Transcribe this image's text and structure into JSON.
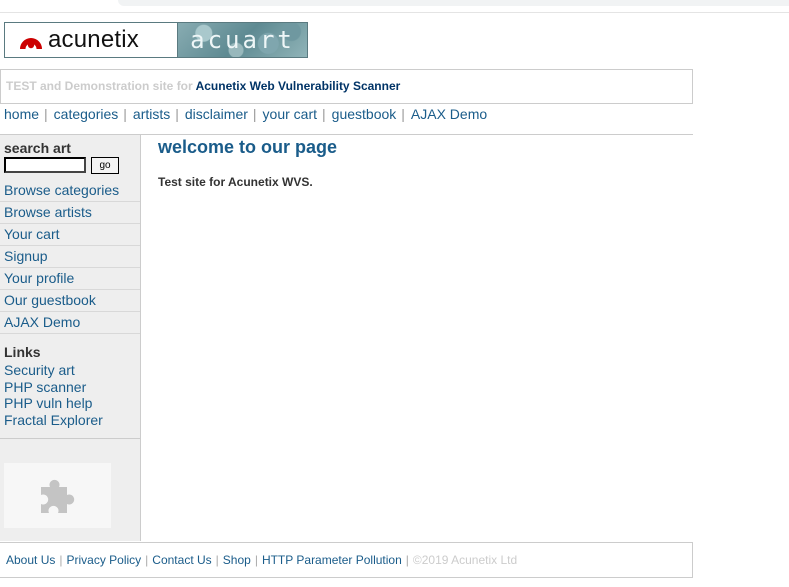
{
  "logo": {
    "left_text": "acunetix",
    "right_text": "acuart",
    "brand_color": "#cc0000"
  },
  "tagline": {
    "prefix": "TEST and Demonstration site for",
    "product": "Acunetix Web Vulnerability Scanner"
  },
  "topnav": {
    "items": [
      {
        "label": "home"
      },
      {
        "label": "categories"
      },
      {
        "label": "artists"
      },
      {
        "label": "disclaimer"
      },
      {
        "label": "your cart"
      },
      {
        "label": "guestbook"
      },
      {
        "label": "AJAX Demo"
      }
    ],
    "separator": "|"
  },
  "sidebar": {
    "search_title": "search art",
    "search_value": "",
    "go_label": "go",
    "items": [
      {
        "label": "Browse categories"
      },
      {
        "label": "Browse artists"
      },
      {
        "label": "Your cart"
      },
      {
        "label": "Signup"
      },
      {
        "label": "Your profile"
      },
      {
        "label": "Our guestbook"
      },
      {
        "label": "AJAX Demo"
      }
    ],
    "links_title": "Links",
    "links": [
      {
        "label": "Security art"
      },
      {
        "label": "PHP scanner"
      },
      {
        "label": "PHP vuln help"
      },
      {
        "label": "Fractal Explorer"
      }
    ],
    "plugin_icon": "puzzle-piece-icon"
  },
  "main": {
    "title": "welcome to our page",
    "text": "Test site for Acunetix WVS."
  },
  "footer": {
    "links": [
      {
        "label": "About Us"
      },
      {
        "label": "Privacy Policy"
      },
      {
        "label": "Contact Us"
      },
      {
        "label": "Shop"
      },
      {
        "label": "HTTP Parameter Pollution"
      }
    ],
    "separator": "|",
    "copyright": "©2019 Acunetix Ltd"
  },
  "colors": {
    "link": "#1a5c8a",
    "heading": "#1a5c8a",
    "sidebar_bg": "#eeeeee",
    "border": "#cccccc"
  }
}
